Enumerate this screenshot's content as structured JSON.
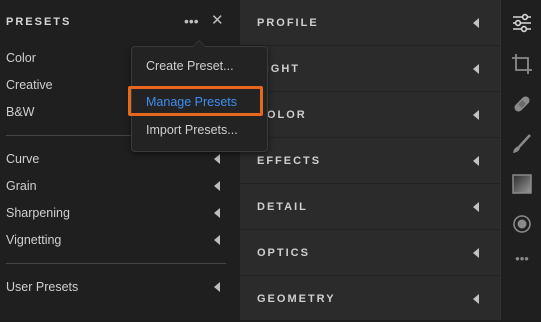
{
  "presets_panel": {
    "title": "PRESETS",
    "more_icon": "more-horizontal-icon",
    "close_icon": "close-icon",
    "groups": [
      {
        "label": "Color"
      },
      {
        "label": "Creative"
      },
      {
        "label": "B&W"
      }
    ],
    "tool_groups": [
      {
        "label": "Curve"
      },
      {
        "label": "Grain"
      },
      {
        "label": "Sharpening"
      },
      {
        "label": "Vignetting"
      }
    ],
    "user_group": {
      "label": "User Presets"
    }
  },
  "sections": [
    {
      "label": "PROFILE"
    },
    {
      "label": "LIGHT"
    },
    {
      "label": "COLOR"
    },
    {
      "label": "EFFECTS"
    },
    {
      "label": "DETAIL"
    },
    {
      "label": "OPTICS"
    },
    {
      "label": "GEOMETRY"
    }
  ],
  "menu": {
    "items": [
      {
        "label": "Create Preset..."
      },
      {
        "label": "Manage Presets"
      },
      {
        "label": "Import Presets..."
      }
    ],
    "highlight_color": "#e8671f",
    "active_color": "#3e8ef0"
  },
  "toolbar": {
    "icons": [
      "sliders-icon",
      "crop-icon",
      "healing-icon",
      "brush-icon",
      "gradient-icon",
      "radial-icon",
      "more-icon"
    ]
  }
}
